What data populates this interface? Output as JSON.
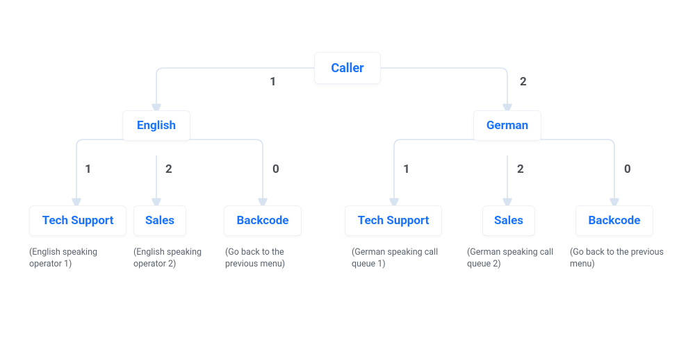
{
  "root": {
    "label": "Caller"
  },
  "edges_root": [
    {
      "num": "1",
      "to": {
        "label": "English"
      }
    },
    {
      "num": "2",
      "to": {
        "label": "German"
      }
    }
  ],
  "english": {
    "label": "English",
    "edges": [
      {
        "num": "1",
        "label": "Tech Support",
        "desc": "(English speaking operator 1)"
      },
      {
        "num": "2",
        "label": "Sales",
        "desc": "(English speaking operator 2)"
      },
      {
        "num": "0",
        "label": "Backcode",
        "desc": "(Go back to the previous menu)"
      }
    ]
  },
  "german": {
    "label": "German",
    "edges": [
      {
        "num": "1",
        "label": "Tech Support",
        "desc": "(German speaking call queue 1)"
      },
      {
        "num": "2",
        "label": "Sales",
        "desc": "(German speaking call queue 2)"
      },
      {
        "num": "0",
        "label": "Backcode",
        "desc": "(Go back to the previous menu)"
      }
    ]
  }
}
